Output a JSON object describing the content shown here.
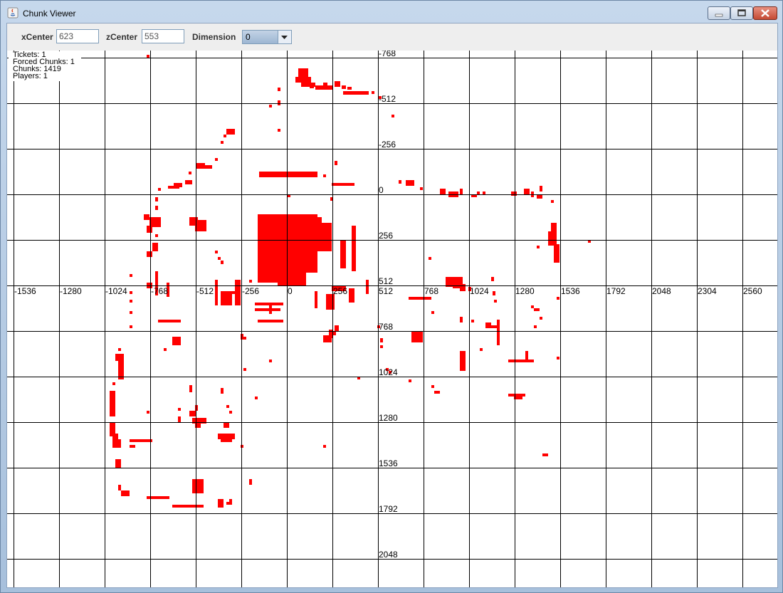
{
  "window": {
    "title": "Chunk Viewer"
  },
  "toolbar": {
    "xcenter_label": "xCenter",
    "xcenter_value": "623",
    "zcenter_label": "zCenter",
    "zcenter_value": "553",
    "dimension_label": "Dimension",
    "dimension_value": "0"
  },
  "stats": {
    "tickets": "Tickets: 1",
    "forced_chunks": "Forced Chunks: 1",
    "chunks": "Chunks: 1419",
    "players": "Players: 1"
  },
  "axes": {
    "x_ticks": [
      "-1536",
      "-1280",
      "-1024",
      "-768",
      "-512",
      "-256",
      "0",
      "256",
      "512",
      "768",
      "1024",
      "1280",
      "1536",
      "1792",
      "2048",
      "2304",
      "2560"
    ],
    "z_ticks": [
      "-768",
      "-512",
      "-256",
      "0",
      "256",
      "512",
      "768",
      "1024",
      "1280",
      "1536",
      "1792",
      "2048"
    ]
  },
  "colors": {
    "chunk": "#ff0000",
    "grid": "#000000",
    "background": "#ffffff"
  }
}
